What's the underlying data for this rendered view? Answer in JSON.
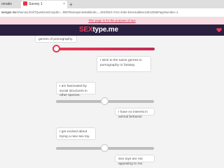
{
  "browser": {
    "tabs": [
      {
        "label": "omatio"
      },
      {
        "label": "Survey 1",
        "close_icon": "×"
      }
    ],
    "new_tab_label": "+",
    "url_domain": "sextype.me",
    "url_path": "/s/survey.html?QuestionGroupID=...99078aresponse6abbede=...3043f4c0-7c0c-42be-b2ee4ad8ee1ab1303&PageNumber=1"
  },
  "banner": {
    "text_before": "",
    "link": "This page is for the purpose of sex",
    "text_after": ""
  },
  "nav": {
    "logo_sex": "SEX",
    "logo_rest": "type.me",
    "heart_icon": "heart-icon"
  },
  "questions": [
    {
      "left_text": "genres of pornography.",
      "right_text": "I stick to the same genres in pornography or fantasy.",
      "value": 0.0
    },
    {
      "left_text": "I am fascinated by social structures in other species.",
      "right_text": "I have no interest in animal behavior.",
      "value": 0.5
    },
    {
      "left_text": "I get excited about trying a new sex toy.",
      "right_text": "Sex toys are not appealing to me.",
      "value": 0.5
    }
  ],
  "colors": {
    "accent": "#e63952",
    "nav_bg": "#2a2040",
    "track_grey": "#bdbdbd",
    "banner_bg": "#f8dce3"
  }
}
